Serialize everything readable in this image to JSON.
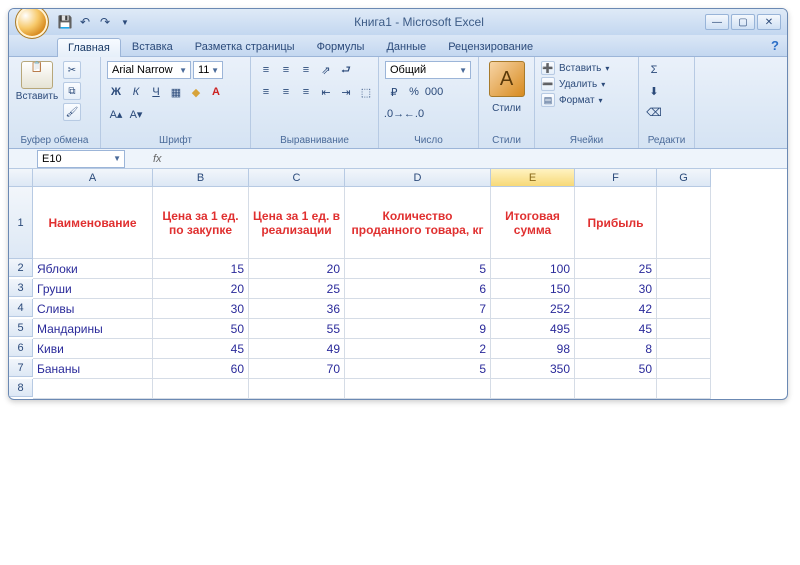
{
  "title": "Книга1 - Microsoft Excel",
  "tabs": [
    "Главная",
    "Вставка",
    "Разметка страницы",
    "Формулы",
    "Данные",
    "Рецензирование"
  ],
  "activeTab": 0,
  "ribbon": {
    "clipboard": {
      "paste": "Вставить",
      "label": "Буфер обмена"
    },
    "font": {
      "name": "Arial Narrow",
      "size": "11",
      "label": "Шрифт"
    },
    "align": {
      "label": "Выравнивание"
    },
    "number": {
      "format": "Общий",
      "label": "Число"
    },
    "styles": {
      "btn": "Стили",
      "label": "Стили"
    },
    "cells": {
      "insert": "Вставить",
      "delete": "Удалить",
      "format": "Формат",
      "label": "Ячейки"
    },
    "editing": {
      "label": "Редакти"
    }
  },
  "namebox": "E10",
  "colHeaders": [
    "A",
    "B",
    "C",
    "D",
    "E",
    "F",
    "G"
  ],
  "tableHeaders": [
    "Наименование",
    "Цена за 1 ед. по закупке",
    "Цена за 1 ед. в реализации",
    "Количество проданного товара, кг",
    "Итоговая сумма",
    "Прибыль"
  ],
  "rows": [
    {
      "n": "2",
      "a": "Яблоки",
      "b": "15",
      "c": "20",
      "d": "5",
      "e": "100",
      "f": "25"
    },
    {
      "n": "3",
      "a": "Груши",
      "b": "20",
      "c": "25",
      "d": "6",
      "e": "150",
      "f": "30"
    },
    {
      "n": "4",
      "a": "Сливы",
      "b": "30",
      "c": "36",
      "d": "7",
      "e": "252",
      "f": "42"
    },
    {
      "n": "5",
      "a": "Мандарины",
      "b": "50",
      "c": "55",
      "d": "9",
      "e": "495",
      "f": "45"
    },
    {
      "n": "6",
      "a": "Киви",
      "b": "45",
      "c": "49",
      "d": "2",
      "e": "98",
      "f": "8"
    },
    {
      "n": "7",
      "a": "Бананы",
      "b": "60",
      "c": "70",
      "d": "5",
      "e": "350",
      "f": "50"
    }
  ]
}
